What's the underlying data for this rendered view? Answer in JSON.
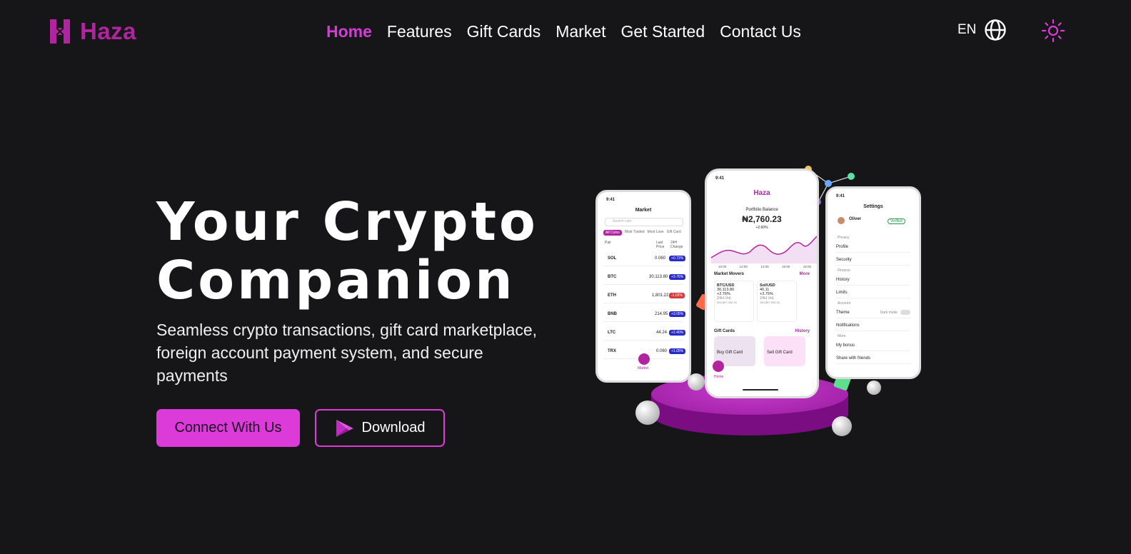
{
  "brand": {
    "name": "Haza",
    "color": "#b0249f",
    "icon": "haza-logo-icon"
  },
  "nav": {
    "items": [
      {
        "label": "Home",
        "active": true
      },
      {
        "label": "Features",
        "active": false
      },
      {
        "label": "Gift Cards",
        "active": false
      },
      {
        "label": "Market",
        "active": false
      },
      {
        "label": "Get Started",
        "active": false
      },
      {
        "label": "Contact Us",
        "active": false
      }
    ],
    "language": "EN",
    "language_icon": "globe-icon",
    "theme_icon": "sun-icon"
  },
  "hero": {
    "title_line1": "Your Crypto",
    "title_line2": "Companion",
    "subtitle": "Seamless crypto transactions, gift card marketplace, foreign account payment system, and secure payments",
    "primary_button": "Connect With Us",
    "secondary_button": "Download",
    "secondary_icon": "play-store-icon"
  },
  "colors": {
    "accent": "#dc3ad9",
    "background": "#161517",
    "text": "#ffffff"
  },
  "phones": {
    "market": {
      "time": "9:41",
      "title": "Market",
      "search_placeholder": "Search coin",
      "filters": [
        "All Coins",
        "Most Traded",
        "Most Lose",
        "Gift Card"
      ],
      "col_pair": "Pair",
      "col_last": "Last Price",
      "col_change": "24H Change",
      "rows": [
        {
          "coin": "SOL",
          "price": "0.060",
          "change": "+0.72%",
          "up": true
        },
        {
          "coin": "BTC",
          "price": "30,113.80",
          "change": "+3.76%",
          "up": true
        },
        {
          "coin": "ETH",
          "price": "1,801.22",
          "change": "-1.02%",
          "up": false
        },
        {
          "coin": "BNB",
          "price": "214.95",
          "change": "+3.05%",
          "up": true
        },
        {
          "coin": "LTC",
          "price": "44.24",
          "change": "+2.40%",
          "up": true
        },
        {
          "coin": "TRX",
          "price": "0.060",
          "change": "+1.05%",
          "up": true
        }
      ],
      "tab_label": "Market"
    },
    "portfolio": {
      "time": "9:41",
      "brand": "Haza",
      "balance_label": "Portfolio Balance",
      "balance": "₦2,760.23",
      "balance_change": "+2.60%",
      "x_ticks": [
        "10:00",
        "12:00",
        "14:00",
        "16:00",
        "18:00"
      ],
      "movers_title": "Market Movers",
      "movers_more": "More",
      "movers": [
        {
          "pair": "BTC/USD",
          "price": "30,113.80",
          "change": "+2.76%",
          "vol": "24H Vol.",
          "vol_value": "394,897,432.26"
        },
        {
          "pair": "Sol/USD",
          "price": "40,11",
          "change": "+3.75%",
          "vol": "24H Vol.",
          "vol_value": "150,897,993.26"
        }
      ],
      "gift_title": "Gift Cards",
      "gift_history": "History",
      "buy_card": "Buy Gift Card",
      "sell_card": "Sell Gift Card",
      "tab_label": "Home"
    },
    "settings": {
      "time": "9:41",
      "title": "Settings",
      "user_name": "Oliver",
      "verified": "Verified",
      "sections": [
        {
          "label": "Privacy",
          "items": [
            "Profile",
            "Security"
          ]
        },
        {
          "label": "Finance",
          "items": [
            "History",
            "Limits"
          ]
        },
        {
          "label": "Account",
          "items": [
            "Theme",
            "Notifications"
          ]
        },
        {
          "label": "More",
          "items": [
            "My bonus",
            "Share with friends"
          ]
        }
      ],
      "dark_mode": "Dark mode"
    }
  }
}
